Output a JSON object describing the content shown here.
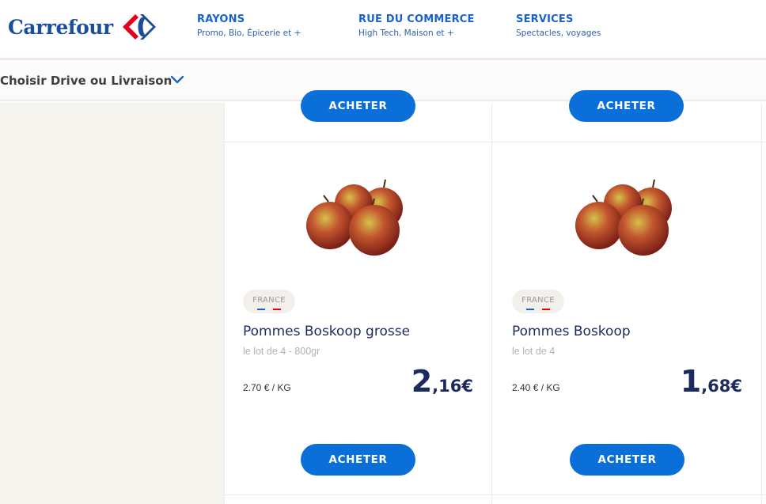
{
  "header": {
    "logo_text": "Carrefour",
    "nav": [
      {
        "title": "RAYONS",
        "subtitle": "Promo, Bio, Épicerie et +"
      },
      {
        "title": "RUE DU COMMERCE",
        "subtitle": "High Tech, Maison et +"
      },
      {
        "title": "SERVICES",
        "subtitle": "Spectacles, voyages"
      }
    ]
  },
  "drive": {
    "label": "Choisir Drive ou Livraison",
    "chevron_icon": "chevron-down-icon"
  },
  "colors": {
    "brand_blue": "#1a4e9b",
    "button_blue": "#0a6fd9",
    "brand_red": "#e2001a",
    "nav_blue": "#1a62c8",
    "price_navy": "#1b2b5e"
  },
  "top_buttons": [
    {
      "label": "ACHETER"
    },
    {
      "label": "ACHETER"
    }
  ],
  "products": [
    {
      "origin": "FRANCE",
      "name": "Pommes Boskoop grosse",
      "description": "le lot de 4 - 800gr",
      "unit_price": "2.70 € / KG",
      "price_int": "2",
      "price_dec": ",16€",
      "button": "ACHETER"
    },
    {
      "origin": "FRANCE",
      "name": "Pommes Boskoop",
      "description": "le lot de 4",
      "unit_price": "2.40 € / KG",
      "price_int": "1",
      "price_dec": ",68€",
      "button": "ACHETER"
    }
  ]
}
